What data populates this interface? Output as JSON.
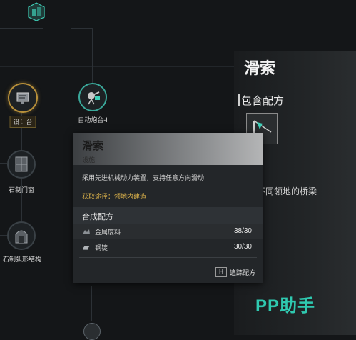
{
  "tree": {
    "nodes": [
      {
        "label": "设计台",
        "icon": "blueprint-icon"
      },
      {
        "label": "自动炮台-I",
        "icon": "turret-icon"
      },
      {
        "label": "石制门窗",
        "icon": "stone-door-icon"
      },
      {
        "label": "石制弧形结构",
        "icon": "stone-arch-icon"
      }
    ]
  },
  "right_panel": {
    "title": "滑索",
    "section_label": "包含配方",
    "description": "不同领地的桥梁",
    "item_icon": "zipline-icon"
  },
  "tooltip": {
    "title": "滑索",
    "category": "设施",
    "description": "采用先进机械动力装置，支持任意方向滑动",
    "source": "获取途径：领地内建造",
    "section_label": "合成配方",
    "materials": [
      {
        "name": "金属废料",
        "count": "38/30",
        "icon": "scrap-metal-icon"
      },
      {
        "name": "钢锭",
        "count": "30/30",
        "icon": "steel-ingot-icon"
      }
    ],
    "key_hint": {
      "key": "H",
      "label": "追踪配方"
    }
  },
  "watermark": "PP助手",
  "colors": {
    "accent_gold": "#d9b04a",
    "watermark_teal": "#2fc9b0",
    "selected_border": "#b8903a"
  }
}
